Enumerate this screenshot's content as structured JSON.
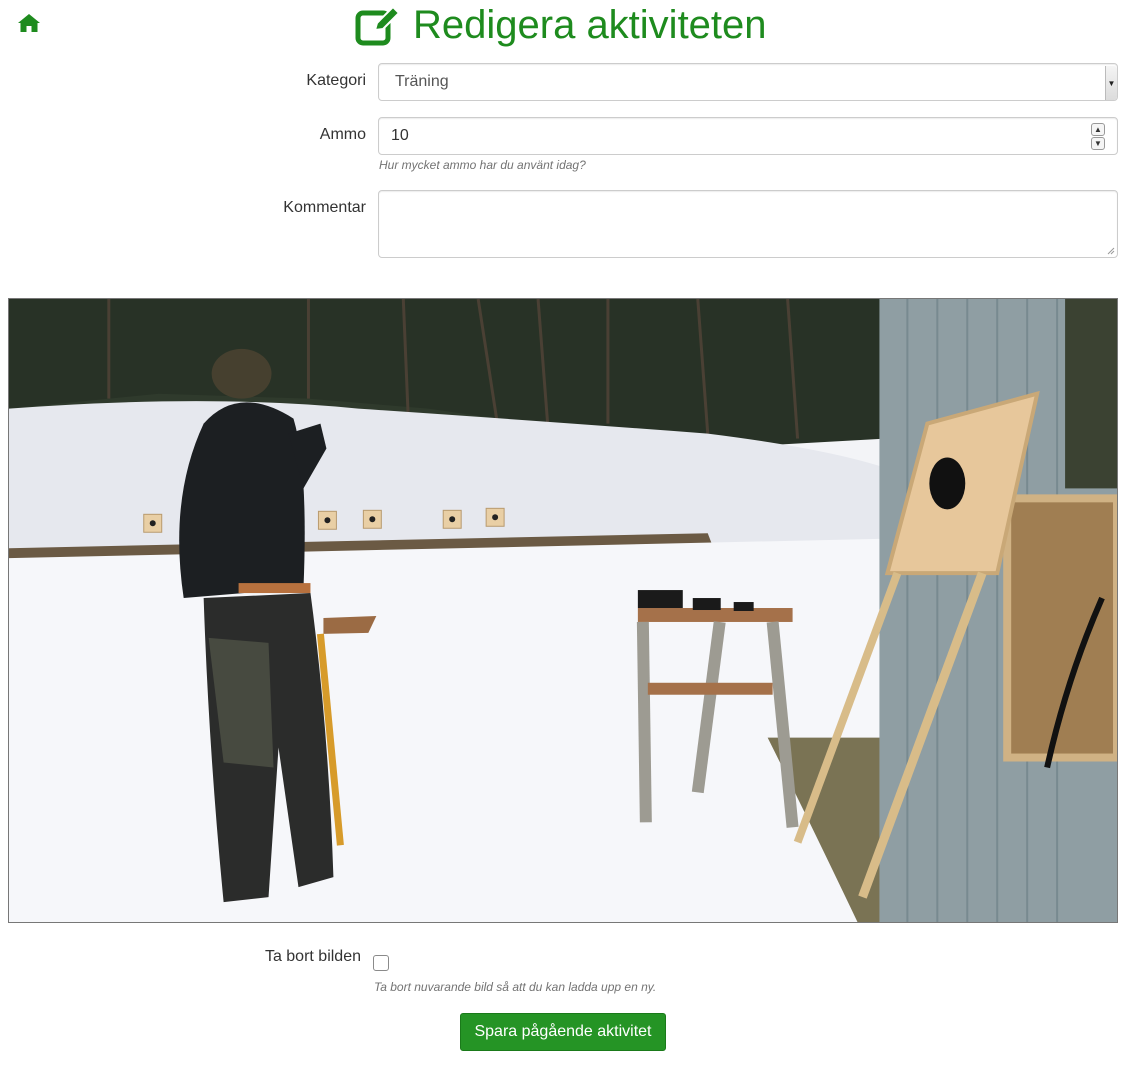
{
  "header": {
    "title": "Redigera aktiviteten",
    "home_icon": "home-icon",
    "edit_icon": "edit-icon"
  },
  "form": {
    "kategori_label": "Kategori",
    "kategori_value": "Träning",
    "ammo_label": "Ammo",
    "ammo_value": "10",
    "ammo_help": "Hur mycket ammo har du använt idag?",
    "kommentar_label": "Kommentar",
    "kommentar_value": "",
    "remove_image_label": "Ta bort bilden",
    "remove_image_checked": false,
    "remove_image_help": "Ta bort nuvarande bild så att du kan ladda upp en ny.",
    "save_label": "Spara pågående aktivitet"
  },
  "image": {
    "description_icon": "activity-photo"
  },
  "colors": {
    "brand_green": "#1e8b1e",
    "button_green": "#259425"
  }
}
